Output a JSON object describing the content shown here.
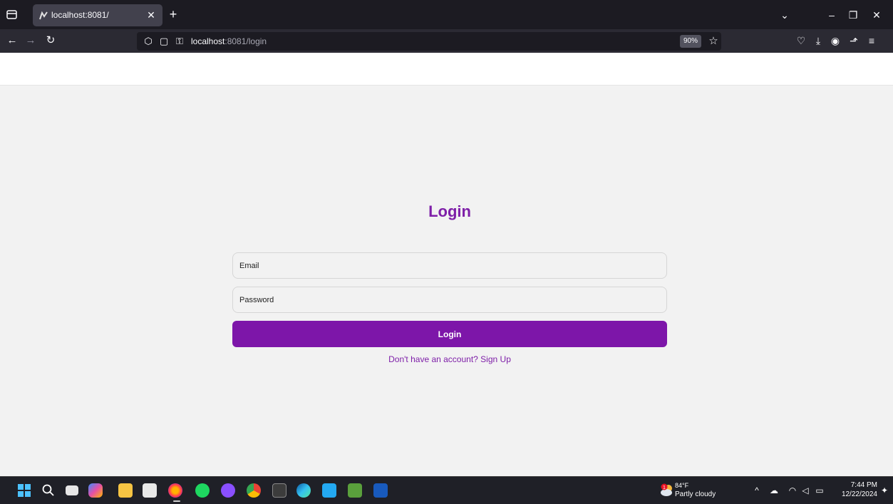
{
  "browser": {
    "tab_title": "localhost:8081/",
    "url_host": "localhost",
    "url_path": ":8081/login",
    "zoom": "90%"
  },
  "login": {
    "title": "Login",
    "email_placeholder": "Email",
    "password_placeholder": "Password",
    "button_label": "Login",
    "signup_text": "Don't have an account? Sign Up"
  },
  "taskbar": {
    "weather_badge": "1",
    "weather_temp": "84°F",
    "weather_desc": "Partly cloudy",
    "clock_time": "7:44 PM",
    "clock_date": "12/22/2024"
  },
  "colors": {
    "accent": "#7d16a9",
    "title": "#7e1fa8",
    "page_bg": "#f2f2f2"
  }
}
